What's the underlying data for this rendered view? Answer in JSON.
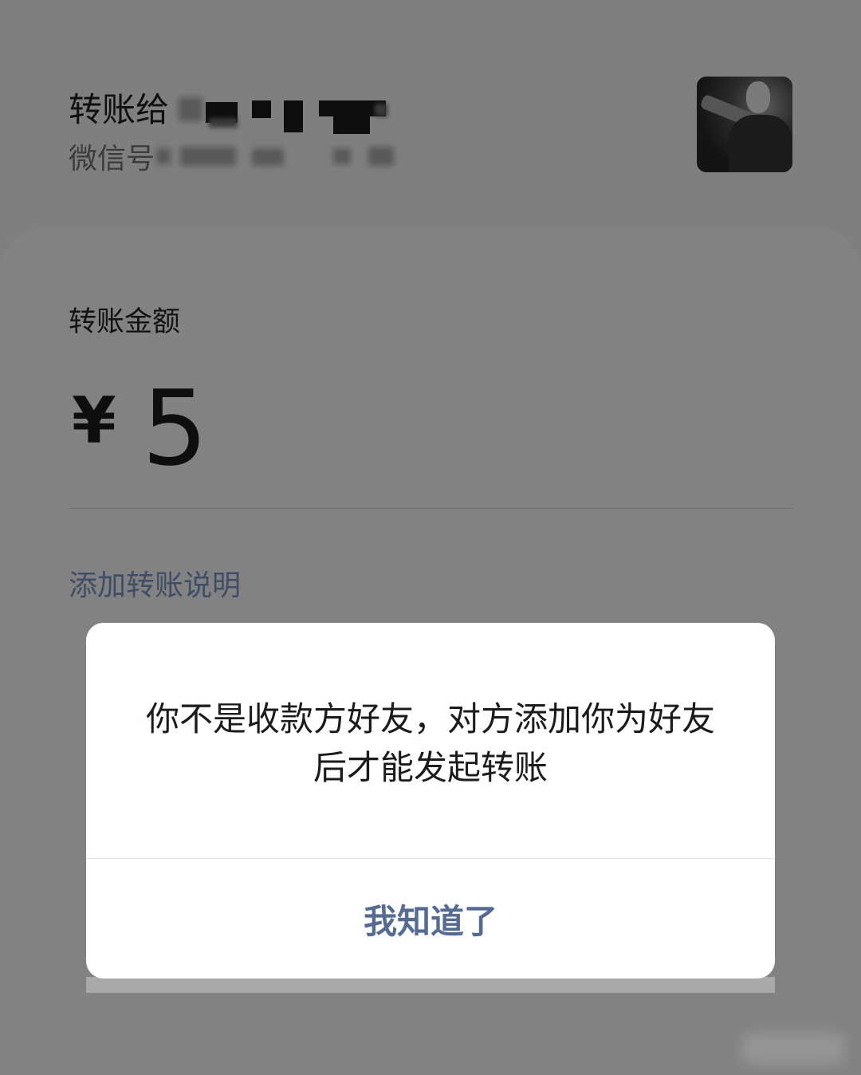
{
  "header": {
    "recipient_title": "转账给",
    "recipient_id_label": "微信号",
    "avatar_name": "contact-avatar"
  },
  "card": {
    "amount_label": "转账金额",
    "currency_symbol": "¥",
    "amount": "5",
    "add_note_link": "添加转账说明"
  },
  "dialog": {
    "message": "你不是收款方好友，对方添加你为好友后才能发起转账",
    "confirm_button": "我知道了"
  },
  "colors": {
    "accent_link": "#566b93",
    "note_link": "#3f4d66",
    "overlay": "#7f7f7f"
  }
}
